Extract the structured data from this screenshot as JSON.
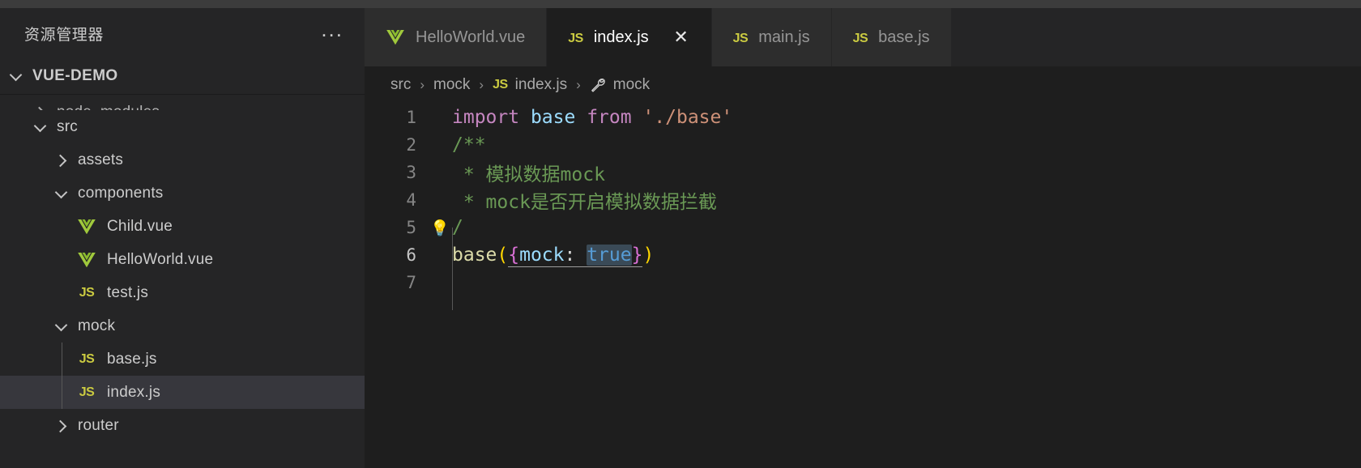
{
  "window": {
    "background": "#1e1e1e",
    "titlebar_color": "#3c3c3c"
  },
  "sidebar": {
    "title": "资源管理器",
    "more_actions_label": "...",
    "root": {
      "label": "VUE-DEMO",
      "expanded": true,
      "chevron": "chevron-down-icon"
    },
    "items": [
      {
        "label": "node_modules",
        "type": "folder",
        "expanded": false,
        "indent": 1,
        "clipped": true
      },
      {
        "label": "src",
        "type": "folder",
        "expanded": true,
        "indent": 1
      },
      {
        "label": "assets",
        "type": "folder",
        "expanded": false,
        "indent": 2
      },
      {
        "label": "components",
        "type": "folder",
        "expanded": true,
        "indent": 2
      },
      {
        "label": "Child.vue",
        "type": "vue",
        "indent": 3
      },
      {
        "label": "HelloWorld.vue",
        "type": "vue",
        "indent": 3
      },
      {
        "label": "test.js",
        "type": "js",
        "indent": 3
      },
      {
        "label": "mock",
        "type": "folder",
        "expanded": true,
        "indent": 2
      },
      {
        "label": "base.js",
        "type": "js",
        "indent": 3
      },
      {
        "label": "index.js",
        "type": "js",
        "indent": 3,
        "selected": true
      },
      {
        "label": "router",
        "type": "folder",
        "expanded": false,
        "indent": 2
      }
    ]
  },
  "tabs": [
    {
      "label": "HelloWorld.vue",
      "icon": "vue-file-icon",
      "active": false,
      "closable": false
    },
    {
      "label": "index.js",
      "icon": "js-file-icon",
      "active": true,
      "closable": true,
      "close_label": "✕"
    },
    {
      "label": "main.js",
      "icon": "js-file-icon",
      "active": false,
      "closable": false
    },
    {
      "label": "base.js",
      "icon": "js-file-icon",
      "active": false,
      "closable": false
    }
  ],
  "breadcrumb": [
    {
      "label": "src",
      "icon": null
    },
    {
      "label": "mock",
      "icon": null
    },
    {
      "label": "index.js",
      "icon": "js-file-icon"
    },
    {
      "label": "mock",
      "icon": "wrench-symbol-icon"
    }
  ],
  "breadcrumb_separator": "›",
  "editor": {
    "file": "index.js",
    "active_line": 6,
    "selection_text": "true",
    "lightbulb_line": 5,
    "lightbulb_icon": "lightbulb-icon",
    "line_numbers": [
      "1",
      "2",
      "3",
      "4",
      "5",
      "6",
      "7"
    ],
    "lines": [
      {
        "n": "1",
        "text": "import base from './base'"
      },
      {
        "n": "2",
        "text": "/**"
      },
      {
        "n": "3",
        "text": " * 模拟数据mock"
      },
      {
        "n": "4",
        "text": " * mock是否开启模拟数据拦截"
      },
      {
        "n": "5",
        "text": " */"
      },
      {
        "n": "6",
        "text": "base({mock: true})"
      },
      {
        "n": "7",
        "text": ""
      }
    ],
    "tokens": {
      "l1_import": "import",
      "l1_base": " base ",
      "l1_from": "from",
      "l1_path": " './base'",
      "l2": "/**",
      "l3": " * 模拟数据mock",
      "l4": " * mock是否开启模拟数据拦截",
      "l5_close": "/",
      "l6_fn": "base",
      "l6_paren_open": "(",
      "l6_brace_open": "{",
      "l6_key": "mock",
      "l6_colon": ": ",
      "l6_value": "true",
      "l6_brace_close": "}",
      "l6_paren_close": ")"
    }
  },
  "colors": {
    "keyword": "#c586c0",
    "variable": "#9cdcfe",
    "string": "#ce9178",
    "comment": "#6a9955",
    "function": "#dcdcaa",
    "paren": "#ffd700",
    "brace": "#da70d6",
    "boolean": "#569cd6",
    "selection": "#3a4a57",
    "js_icon": "#cbcb41",
    "vue_icon": "#a0c93c",
    "selected_row": "#37373d"
  }
}
